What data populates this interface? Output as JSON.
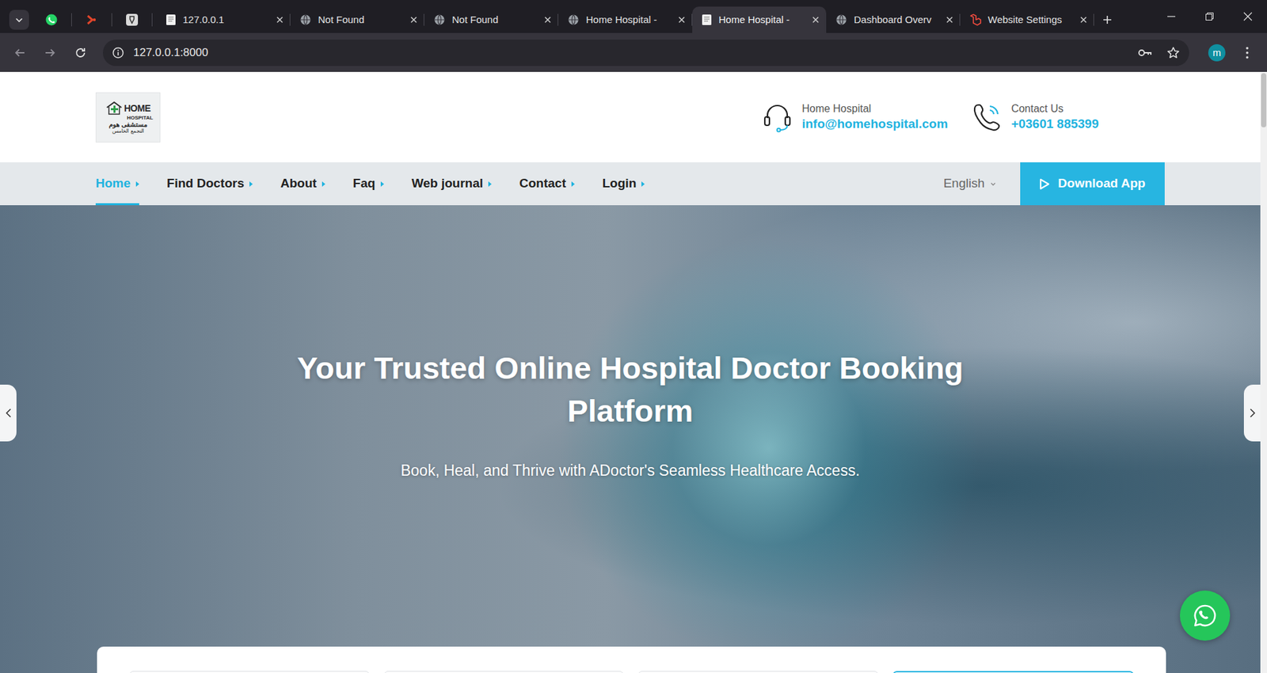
{
  "browser": {
    "tabs": [
      {
        "label": "127.0.0.1",
        "kind": "doc",
        "selected": false
      },
      {
        "label": "Not Found",
        "kind": "globe",
        "selected": false
      },
      {
        "label": "Not Found",
        "kind": "globe",
        "selected": false
      },
      {
        "label": "Home Hospital -",
        "kind": "globe",
        "selected": false
      },
      {
        "label": "Home Hospital -",
        "kind": "doc",
        "selected": true
      },
      {
        "label": "Dashboard Overv",
        "kind": "globe",
        "selected": false
      },
      {
        "label": "Website Settings",
        "kind": "laravel",
        "selected": false
      }
    ],
    "address": "127.0.0.1:8000",
    "profile": "m"
  },
  "site": {
    "logo": {
      "line1": "HOME",
      "line2": "HOSPITAL",
      "line3": "مستشفى هوم",
      "line4": "التجمع الخامس"
    },
    "contacts": [
      {
        "label": "Home Hospital",
        "value": "info@homehospital.com",
        "kind": "headset"
      },
      {
        "label": "Contact Us",
        "value": "+03601 885399",
        "kind": "phone"
      }
    ],
    "nav": [
      {
        "label": "Home",
        "selected": true
      },
      {
        "label": "Find Doctors",
        "selected": false
      },
      {
        "label": "About",
        "selected": false
      },
      {
        "label": "Faq",
        "selected": false
      },
      {
        "label": "Web journal",
        "selected": false
      },
      {
        "label": "Contact",
        "selected": false
      },
      {
        "label": "Login",
        "selected": false
      }
    ],
    "language": "English",
    "download": "Download App",
    "hero": {
      "title": "Your Trusted Online Hospital Doctor Booking Platform",
      "subtitle": "Book, Heal, and Thrive with ADoctor's Seamless Healthcare Access."
    },
    "scrollbar": {
      "level": 0.09
    }
  }
}
